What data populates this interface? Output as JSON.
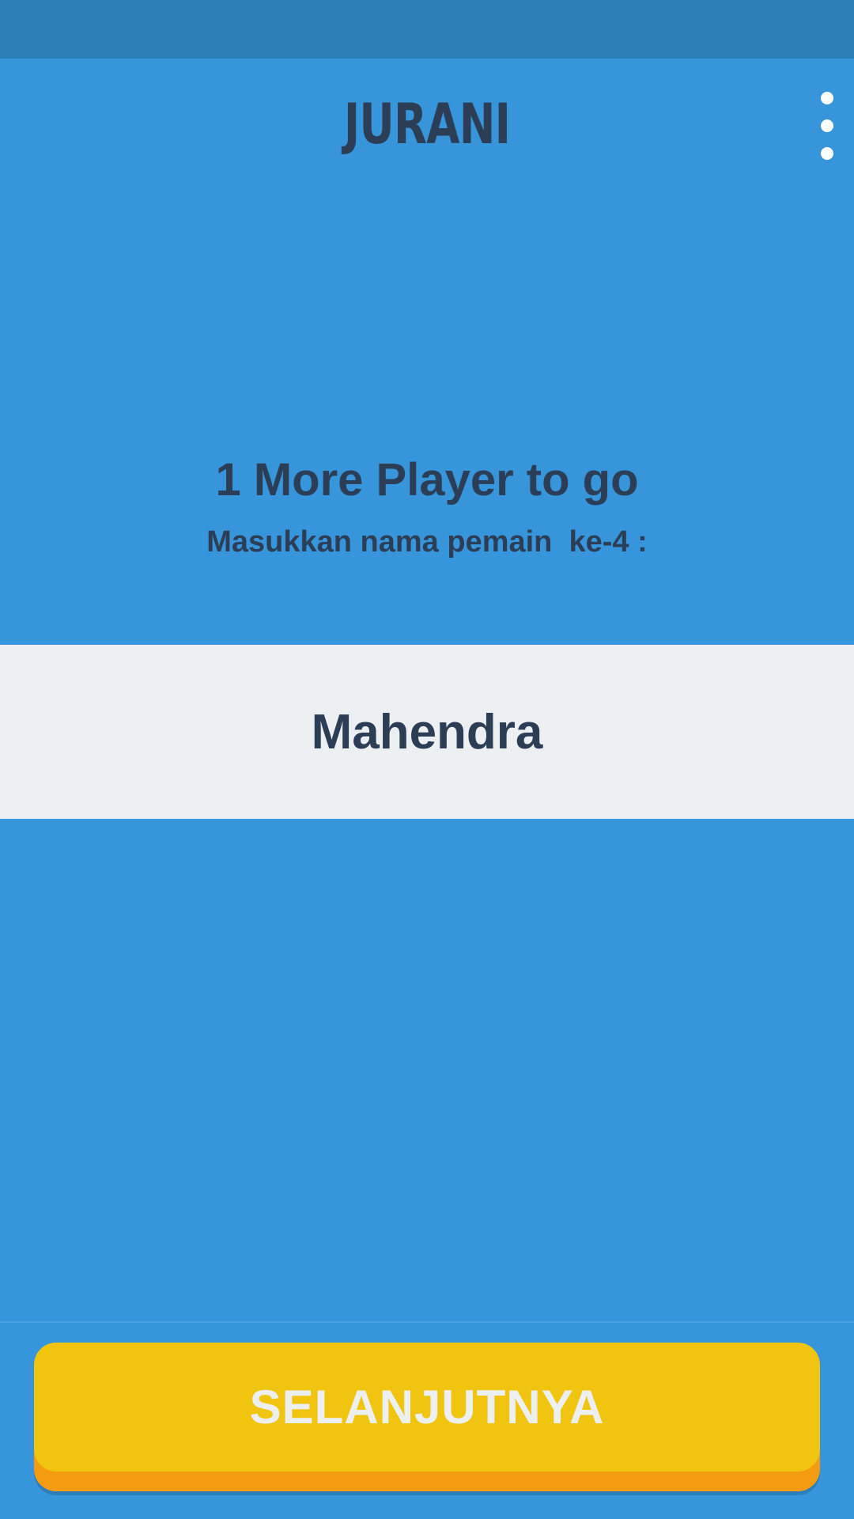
{
  "app": {
    "title": "JURANI"
  },
  "menu": {
    "icon": "more-vert-icon"
  },
  "content": {
    "heading": "1 More Player to go",
    "subheading": "Masukkan nama pemain  ke-4 :"
  },
  "player_input": {
    "value": "Mahendra"
  },
  "footer": {
    "next_label": "SELANJUTNYA"
  },
  "colors": {
    "background": "#3796db",
    "status_bar": "#2c80ba",
    "text_dark": "#2c3e55",
    "input_background": "#ecf0f3",
    "button_yellow": "#f1c40f",
    "button_orange": "#f39c12"
  }
}
